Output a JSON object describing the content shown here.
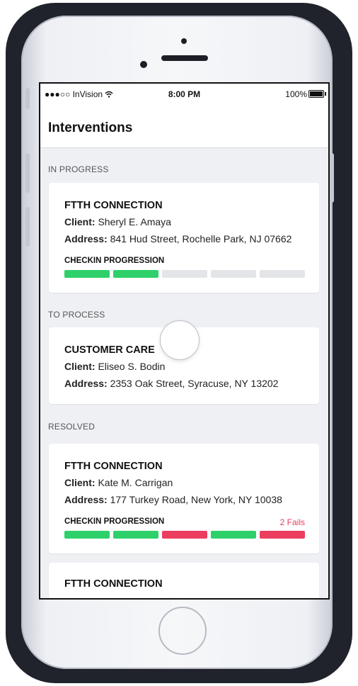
{
  "status_bar": {
    "carrier": "●●●○○ InVision",
    "wifi_icon": "wifi-icon",
    "time": "8:00 PM",
    "battery": "100%"
  },
  "nav": {
    "title": "Interventions"
  },
  "sections": {
    "in_progress": "IN PROGRESS",
    "to_process": "TO PROCESS",
    "resolved": "RESOLVED"
  },
  "cards": [
    {
      "title": "FTTH CONNECTION",
      "client_label": "Client:",
      "client": "Sheryl E. Amaya",
      "address_label": "Address:",
      "address": "841 Hud Street, Rochelle Park, NJ 07662",
      "progress_label": "CHECKIN PROGRESSION",
      "progress": [
        "done",
        "done",
        "pending",
        "pending",
        "pending"
      ]
    },
    {
      "title": "CUSTOMER CARE",
      "client_label": "Client:",
      "client": "Eliseo S. Bodin",
      "address_label": "Address:",
      "address": "2353 Oak Street, Syracuse, NY 13202"
    },
    {
      "title": "FTTH CONNECTION",
      "client_label": "Client:",
      "client": "Kate M. Carrigan",
      "address_label": "Address:",
      "address": "177 Turkey Road, New York, NY 10038",
      "progress_label": "CHECKIN PROGRESSION",
      "fails": "2 Fails",
      "progress": [
        "done",
        "done",
        "fail",
        "done",
        "fail"
      ]
    },
    {
      "title": "FTTH CONNECTION"
    }
  ],
  "colors": {
    "done": "#2ed06a",
    "fail": "#ec3d5f",
    "pending": "#e4e5e8"
  }
}
